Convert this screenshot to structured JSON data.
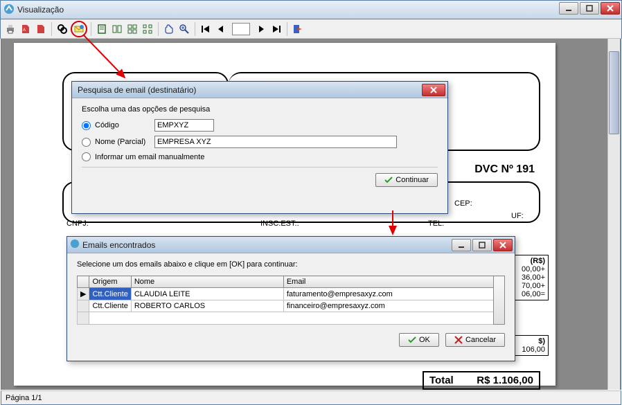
{
  "main_window": {
    "title": "Visualização"
  },
  "toolbar": {
    "icons": [
      "print",
      "pdf",
      "word",
      "search",
      "email",
      "view1",
      "view2",
      "grid",
      "thumb",
      "hand",
      "zoomplus",
      "first",
      "prev",
      "next",
      "last",
      "exit"
    ]
  },
  "doc": {
    "dvc_label": "DVC Nº 191",
    "cnpj_label": "CNPJ:",
    "inscest_label": "INSC.EST.:",
    "tel_label": "TEL:",
    "cep_label": "CEP:",
    "uf_label": "UF:",
    "col_rs": "(R$)",
    "lines": [
      "00,00+",
      "36,00+",
      "70,00+",
      "06,00="
    ],
    "box2_rs": "$)",
    "box2_val": "106,00",
    "total_label": "Total",
    "total_value": "R$ 1.106,00"
  },
  "dialog1": {
    "title": "Pesquisa de email (destinatário)",
    "group_label": "Escolha uma das opções de pesquisa",
    "opt_codigo": "Código",
    "opt_nome": "Nome (Parcial)",
    "opt_manual": "Informar um email manualmente",
    "codigo_value": "EMPXYZ",
    "nome_value": "EMPRESA XYZ",
    "btn_continue": "Continuar"
  },
  "dialog2": {
    "title": "Emails encontrados",
    "instruction": "Selecione um dos emails abaixo e clique em [OK] para continuar:",
    "col_origem": "Origem",
    "col_nome": "Nome",
    "col_email": "Email",
    "rows": [
      {
        "origem": "Ctt.Cliente",
        "nome": "CLAUDIA LEITE",
        "email": "faturamento@empresaxyz.com"
      },
      {
        "origem": "Ctt.Cliente",
        "nome": "ROBERTO CARLOS",
        "email": "financeiro@empresaxyz.com"
      }
    ],
    "btn_ok": "OK",
    "btn_cancel": "Cancelar"
  },
  "statusbar": {
    "page": "Página 1/1"
  }
}
